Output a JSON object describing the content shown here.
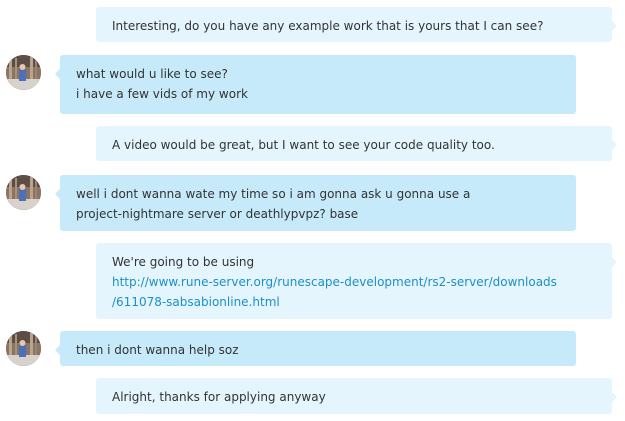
{
  "conversation": {
    "messages": [
      {
        "direction": "outgoing",
        "lines": [
          "Interesting, do you have any example work that is yours that I can see?"
        ]
      },
      {
        "direction": "incoming",
        "lines": [
          "what would u like to see?",
          "i have a few vids of my work"
        ]
      },
      {
        "direction": "outgoing",
        "lines": [
          "A video would be great, but I want to see your code quality too."
        ]
      },
      {
        "direction": "incoming",
        "lines": [
          "well i dont wanna wate my time so i am gonna ask u gonna use a",
          "project-nightmare server or deathlypvpz? base"
        ]
      },
      {
        "direction": "outgoing",
        "lines": [
          "We're going to be using"
        ],
        "link_lines": [
          "http://www.rune-server.org/runescape-development/rs2-server/downloads",
          "/611078-sabsabionline.html"
        ]
      },
      {
        "direction": "incoming",
        "lines": [
          "then i dont wanna help soz"
        ]
      },
      {
        "direction": "outgoing",
        "lines": [
          "Alright, thanks for applying anyway"
        ]
      }
    ]
  },
  "colors": {
    "outgoing_bubble": "#e4f5fd",
    "incoming_bubble": "#c6eafa",
    "link": "#1c8fc8",
    "text": "#333333"
  },
  "icons": {
    "contact_avatar": "user-avatar-icon"
  }
}
